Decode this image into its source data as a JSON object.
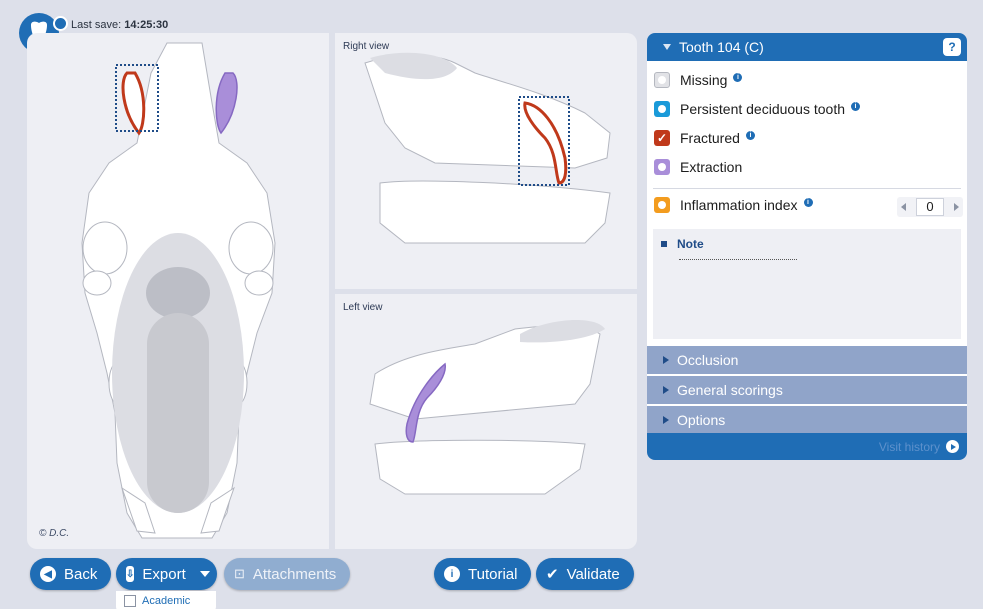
{
  "header": {
    "last_save_label": "Last save:",
    "last_save_time": "14:25:30"
  },
  "views": {
    "right_label": "Right view",
    "left_label": "Left view",
    "copyright": "© D.C."
  },
  "colors": {
    "primary": "#1f6db5",
    "fractured": "#c0391b",
    "extraction": "#a98ed9",
    "persistent": "#1a9ad9",
    "inflammation": "#f39c1e"
  },
  "buttons": {
    "back": "Back",
    "export": "Export",
    "attachments": "Attachments",
    "tutorial": "Tutorial",
    "validate": "Validate",
    "academic": "Academic"
  },
  "side": {
    "title": "Tooth 104 (C)",
    "help": "?",
    "options": [
      {
        "label": "Missing"
      },
      {
        "label": "Persistent deciduous tooth"
      },
      {
        "label": "Fractured",
        "checked": true
      },
      {
        "label": "Extraction"
      }
    ],
    "inflammation_label": "Inflammation index",
    "inflammation_value": "0",
    "note_title": "Note",
    "sections": [
      "Occlusion",
      "General scorings",
      "Options"
    ],
    "visit_history": "Visit history"
  }
}
